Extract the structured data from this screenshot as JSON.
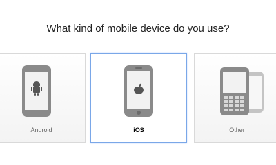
{
  "question": "What kind of mobile device do you use?",
  "options": [
    {
      "label": "Android",
      "icon": "android-phone-icon",
      "selected": false
    },
    {
      "label": "iOS",
      "icon": "iphone-icon",
      "selected": true
    },
    {
      "label": "Other",
      "icon": "blackberry-phone-icon",
      "selected": false
    }
  ],
  "colors": {
    "selected_border": "#7aa7e8",
    "card_border": "#d9d9d9",
    "device_gray": "#8a8a8a",
    "screen_fill": "#f2f2f2"
  }
}
